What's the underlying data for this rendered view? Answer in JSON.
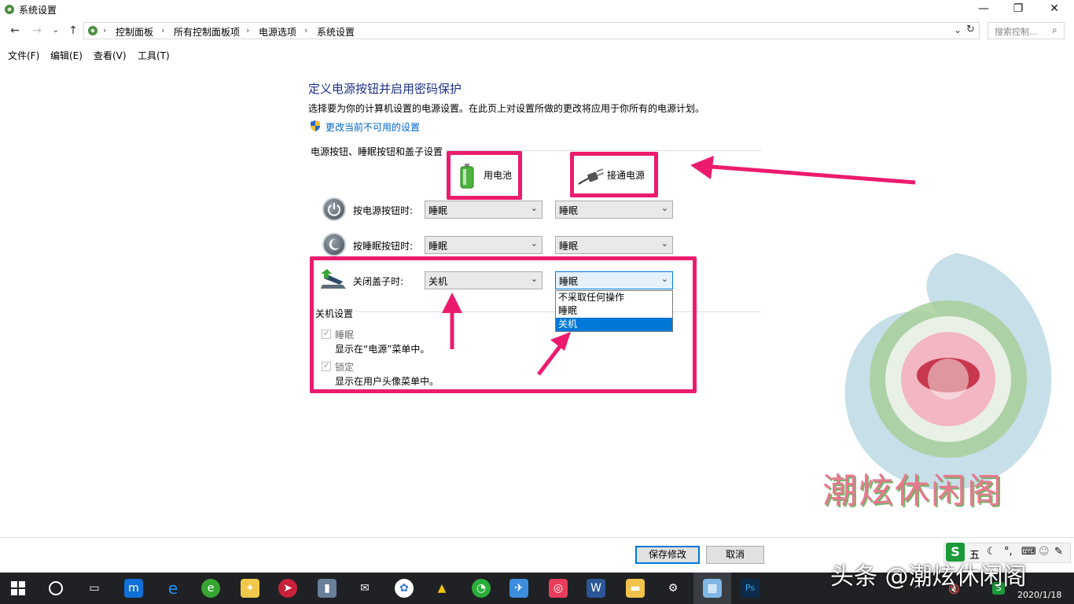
{
  "window": {
    "title": "系统设置",
    "controls": {
      "minimize": "—",
      "maximize": "❐",
      "close": "✕"
    }
  },
  "breadcrumb": [
    "控制面板",
    "所有控制面板项",
    "电源选项",
    "系统设置"
  ],
  "search": {
    "placeholder": "搜索控制..."
  },
  "menu": [
    "文件(F)",
    "编辑(E)",
    "查看(V)",
    "工具(T)"
  ],
  "main": {
    "heading": "定义电源按钮并启用密码保护",
    "description": "选择要为你的计算机设置的电源设置。在此页上对设置所做的更改将应用于你所有的电源计划。",
    "change_link": "更改当前不可用的设置",
    "section_power": "电源按钮、睡眠按钮和盖子设置",
    "col_battery": "用电池",
    "col_plugged": "接通电源",
    "rows": [
      {
        "label": "按电源按钮时:",
        "battery": "睡眠",
        "plugged": "睡眠"
      },
      {
        "label": "按睡眠按钮时:",
        "battery": "睡眠",
        "plugged": "睡眠"
      },
      {
        "label": "关闭盖子时:",
        "battery": "关机",
        "plugged": "睡眠"
      }
    ],
    "dropdown_options": [
      "不采取任何操作",
      "睡眠",
      "关机"
    ],
    "dropdown_selected": "关机",
    "section_shutdown": "关机设置",
    "shutdown_items": [
      {
        "label": "睡眠",
        "desc": "显示在“电源”菜单中。",
        "checked": true
      },
      {
        "label": "锁定",
        "desc": "显示在用户头像菜单中。",
        "checked": true
      }
    ]
  },
  "footer": {
    "save": "保存修改",
    "cancel": "取消"
  },
  "overlay": {
    "logo_text": "潮炫休闲阁",
    "watermark": "头条 @潮炫休闲阁",
    "accent": "#ec1b6e"
  },
  "taskbar": {
    "ime": "五",
    "date": "2020/1/18"
  }
}
